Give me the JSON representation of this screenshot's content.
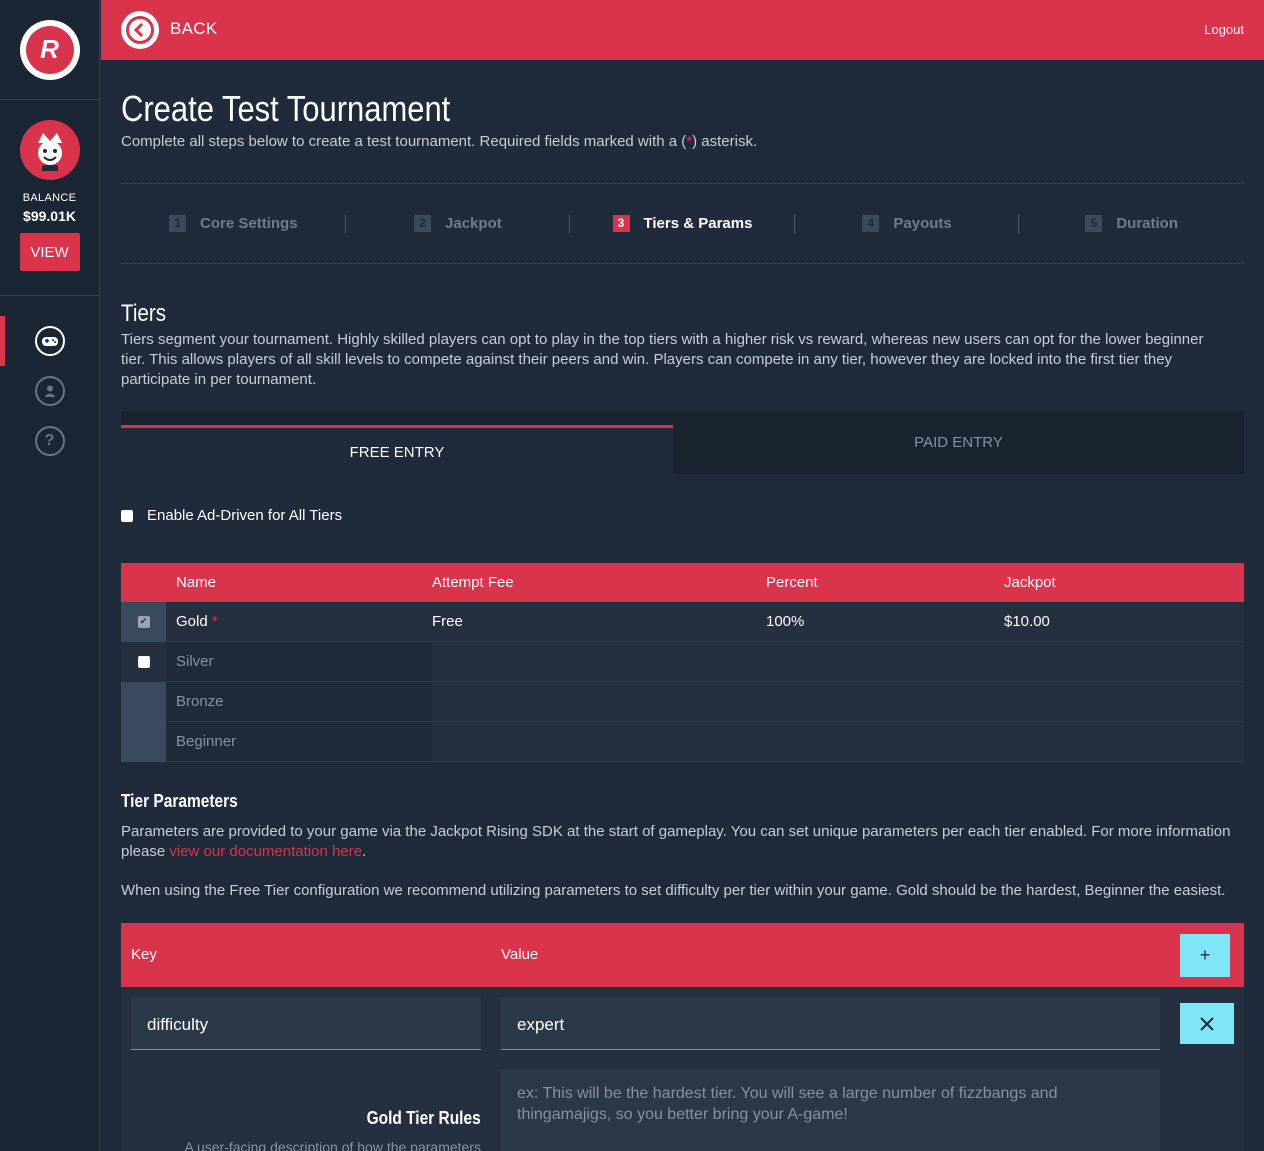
{
  "sidebar": {
    "logo_letter": "R",
    "balance_label": "BALANCE",
    "balance_value": "$99.01K",
    "view_label": "VIEW",
    "help_glyph": "?"
  },
  "topbar": {
    "back_label": "BACK",
    "logout_label": "Logout"
  },
  "page": {
    "title": "Create Test Tournament",
    "subtitle_pre": "Complete all steps below to create a test tournament. Required fields marked with a (",
    "subtitle_star": "*",
    "subtitle_post": ") asterisk."
  },
  "steps": [
    {
      "num": "1",
      "label": "Core Settings"
    },
    {
      "num": "2",
      "label": "Jackpot"
    },
    {
      "num": "3",
      "label": "Tiers & Params"
    },
    {
      "num": "4",
      "label": "Payouts"
    },
    {
      "num": "5",
      "label": "Duration"
    }
  ],
  "tiers": {
    "title": "Tiers",
    "description": "Tiers segment your tournament. Highly skilled players can opt to play in the top tiers with a higher risk vs reward, whereas new users can opt for the lower beginner tier. This allows players of all skill levels to compete against their peers and win. Players can compete in any tier, however they are locked into the first tier they participate in per tournament.",
    "tab_free": "FREE ENTRY",
    "tab_paid": "PAID ENTRY",
    "ad_label": "Enable Ad-Driven for All Tiers",
    "columns": {
      "name": "Name",
      "fee": "Attempt Fee",
      "percent": "Percent",
      "jackpot": "Jackpot"
    },
    "rows": [
      {
        "name": "Gold",
        "star": "*",
        "fee": "Free",
        "percent": "100%",
        "jackpot": "$10.00"
      },
      {
        "name": "Silver",
        "star": "",
        "fee": "",
        "percent": "",
        "jackpot": ""
      },
      {
        "name": "Bronze",
        "star": "",
        "fee": "",
        "percent": "",
        "jackpot": ""
      },
      {
        "name": "Beginner",
        "star": "",
        "fee": "",
        "percent": "",
        "jackpot": ""
      }
    ]
  },
  "params": {
    "title": "Tier Parameters",
    "desc_pre": "Parameters are provided to your game via the Jackpot Rising SDK at the start of gameplay. You can set unique parameters per each tier enabled. For more information please ",
    "desc_link": "view our documentation here",
    "desc_post": ".",
    "note": "When using the Free Tier configuration we recommend utilizing parameters to set difficulty per tier within your game. Gold should be the hardest, Beginner the easiest.",
    "key_header": "Key",
    "value_header": "Value",
    "add_label": "+",
    "key_value": "difficulty",
    "value_value": "expert",
    "rules_title": "Gold Tier Rules",
    "rules_sub": "A user-facing description of how the parameters",
    "rules_placeholder": "ex: This will be the hardest tier. You will see a large number of fizzbangs and thingamajigs, so you better bring your A-game!"
  },
  "colors": {
    "accent": "#d9344b",
    "background": "#1f2b3a",
    "button_cyan": "#7fe6f7"
  }
}
